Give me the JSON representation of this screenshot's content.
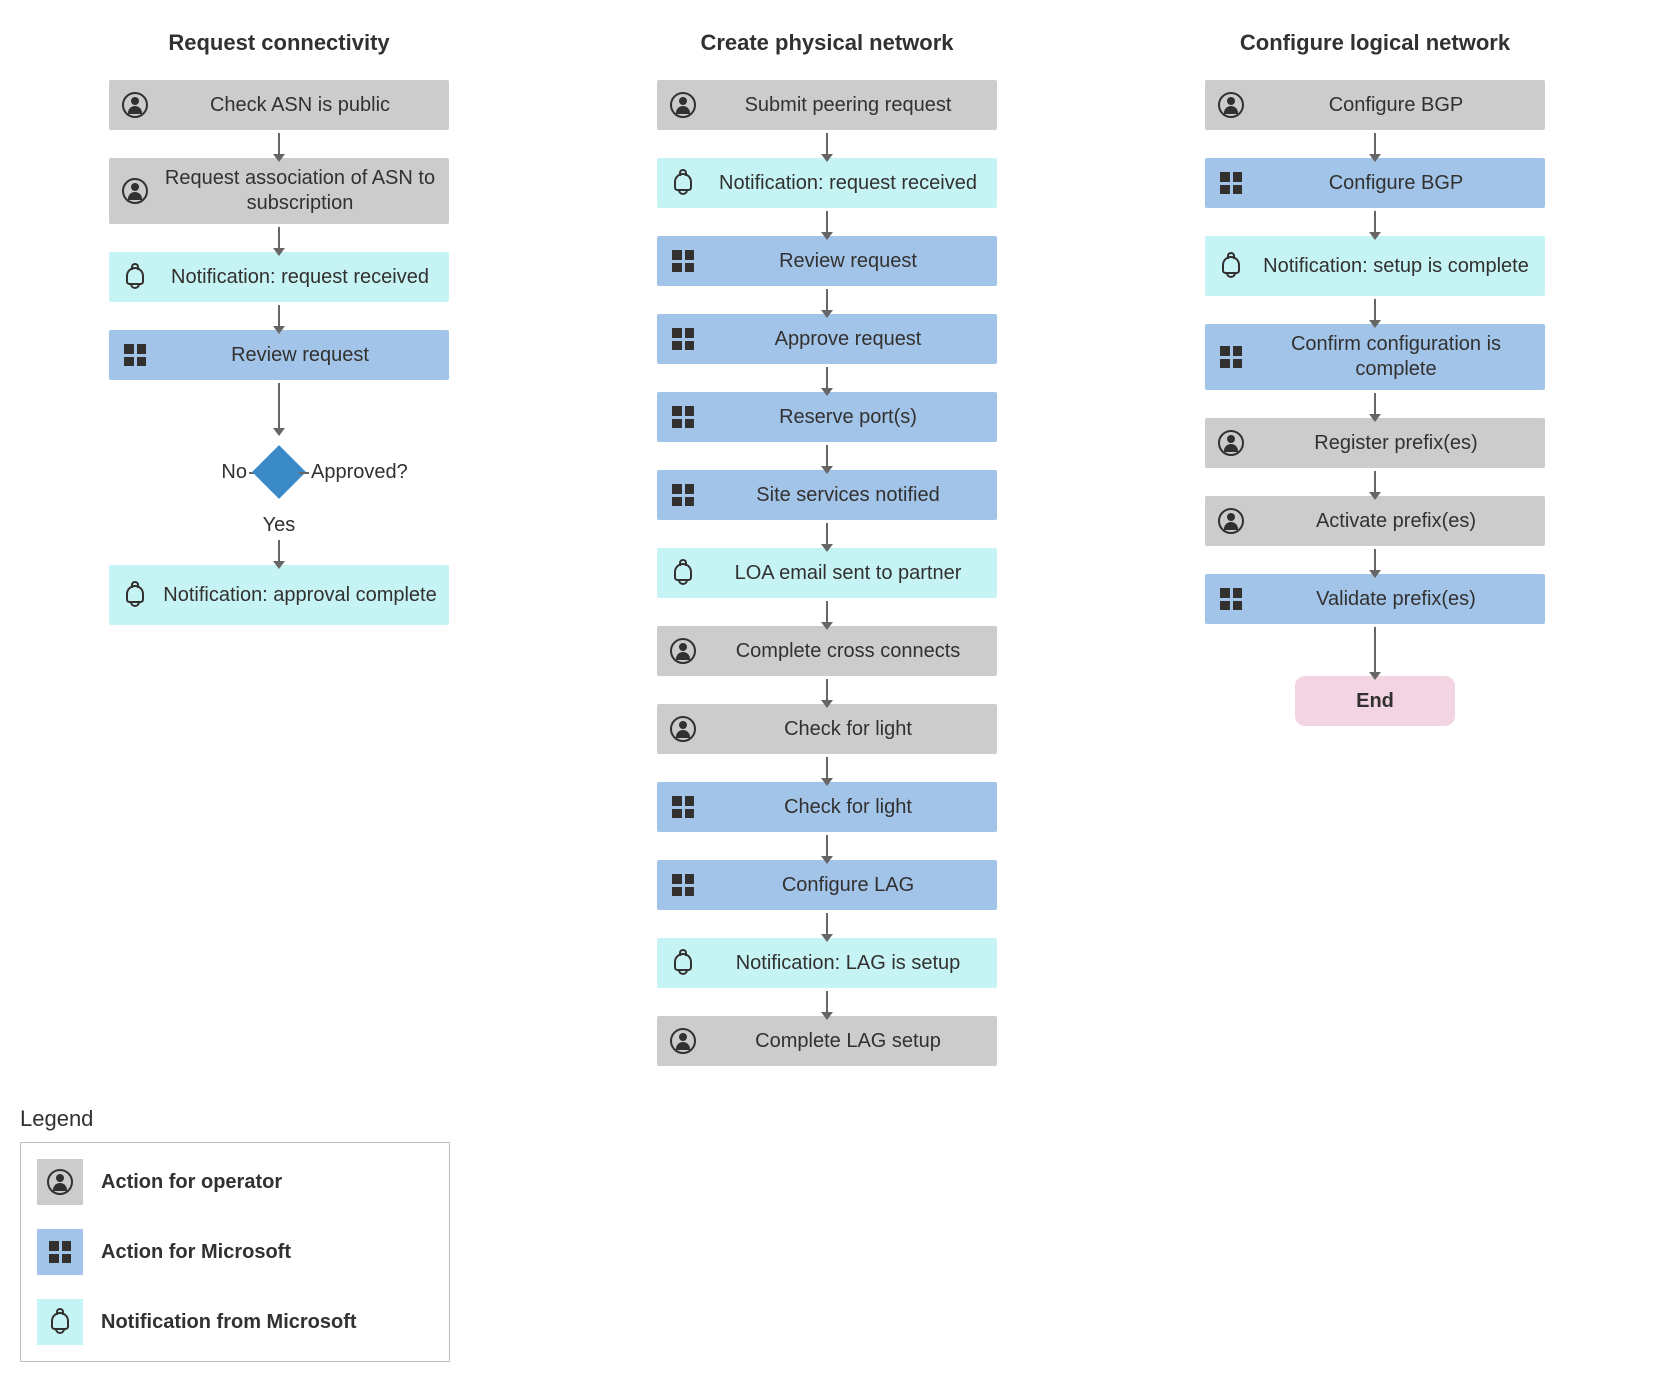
{
  "headings": {
    "col1": "Request connectivity",
    "col2": "Create physical network",
    "col3": "Configure logical network"
  },
  "decision": {
    "question": "Approved?",
    "no": "No",
    "yes": "Yes"
  },
  "col1_steps": [
    {
      "kind": "operator",
      "text": "Check ASN is public"
    },
    {
      "kind": "operator",
      "text": "Request association of ASN to subscription",
      "multi": true
    },
    {
      "kind": "notify",
      "text": "Notification: request received"
    },
    {
      "kind": "microsoft",
      "text": "Review request"
    }
  ],
  "col1_after_decision": [
    {
      "kind": "notify",
      "text": "Notification: approval complete",
      "multi": true
    }
  ],
  "col2_steps": [
    {
      "kind": "operator",
      "text": "Submit peering request"
    },
    {
      "kind": "notify",
      "text": "Notification: request received"
    },
    {
      "kind": "microsoft",
      "text": "Review request"
    },
    {
      "kind": "microsoft",
      "text": "Approve request"
    },
    {
      "kind": "microsoft",
      "text": "Reserve port(s)"
    },
    {
      "kind": "microsoft",
      "text": "Site services notified"
    },
    {
      "kind": "notify",
      "text": "LOA email sent to partner"
    },
    {
      "kind": "operator",
      "text": "Complete cross connects"
    },
    {
      "kind": "operator",
      "text": "Check for light"
    },
    {
      "kind": "microsoft",
      "text": "Check for light"
    },
    {
      "kind": "microsoft",
      "text": "Configure LAG"
    },
    {
      "kind": "notify",
      "text": "Notification: LAG is setup"
    },
    {
      "kind": "operator",
      "text": "Complete LAG setup"
    }
  ],
  "col3_steps": [
    {
      "kind": "operator",
      "text": "Configure BGP"
    },
    {
      "kind": "microsoft",
      "text": "Configure BGP"
    },
    {
      "kind": "notify",
      "text": "Notification: setup is complete",
      "multi": true
    },
    {
      "kind": "microsoft",
      "text": "Confirm configuration is complete",
      "multi": true
    },
    {
      "kind": "operator",
      "text": "Register prefix(es)"
    },
    {
      "kind": "operator",
      "text": "Activate prefix(es)"
    },
    {
      "kind": "microsoft",
      "text": "Validate prefix(es)"
    }
  ],
  "end_label": "End",
  "legend": {
    "title": "Legend",
    "items": [
      {
        "kind": "operator",
        "text": "Action for operator"
      },
      {
        "kind": "microsoft",
        "text": "Action for Microsoft"
      },
      {
        "kind": "notify",
        "text": "Notification from Microsoft"
      }
    ]
  }
}
